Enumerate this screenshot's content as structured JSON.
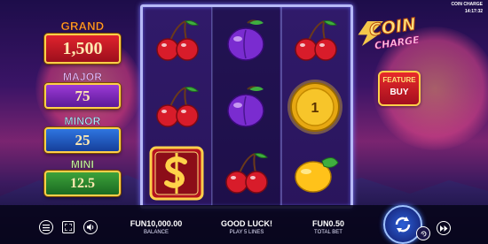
{
  "game": {
    "title": "COIN CHARGE",
    "clock": "14:17:32"
  },
  "jackpots": {
    "grand": {
      "label": "GRAND",
      "value": "1,500",
      "color": "#e0232d"
    },
    "major": {
      "label": "MAJOR",
      "value": "75",
      "color": "#9c3ad6"
    },
    "minor": {
      "label": "MINOR",
      "value": "25",
      "color": "#2f75e0"
    },
    "mini": {
      "label": "MINI",
      "value": "12.5",
      "color": "#3da23a"
    }
  },
  "reels": [
    [
      "cherries-icon",
      "cherries-icon",
      "dollar-bonus-icon"
    ],
    [
      "plum-icon",
      "plum-icon",
      "cherries-icon"
    ],
    [
      "cherries-icon",
      "coin-1-icon",
      "lemon-icon"
    ]
  ],
  "coin_value": "1",
  "logo": {
    "line1": "COIN",
    "line2": "CHARGE"
  },
  "feature_buy": {
    "line1": "FEATURE",
    "line2": "BUY"
  },
  "bottom": {
    "balance_value": "FUN10,000.00",
    "balance_label": "BALANCE",
    "message": "GOOD LUCK!",
    "lines": "PLAY 5 LINES",
    "bet_value": "FUN0.50",
    "bet_label": "TOTAL BET"
  }
}
